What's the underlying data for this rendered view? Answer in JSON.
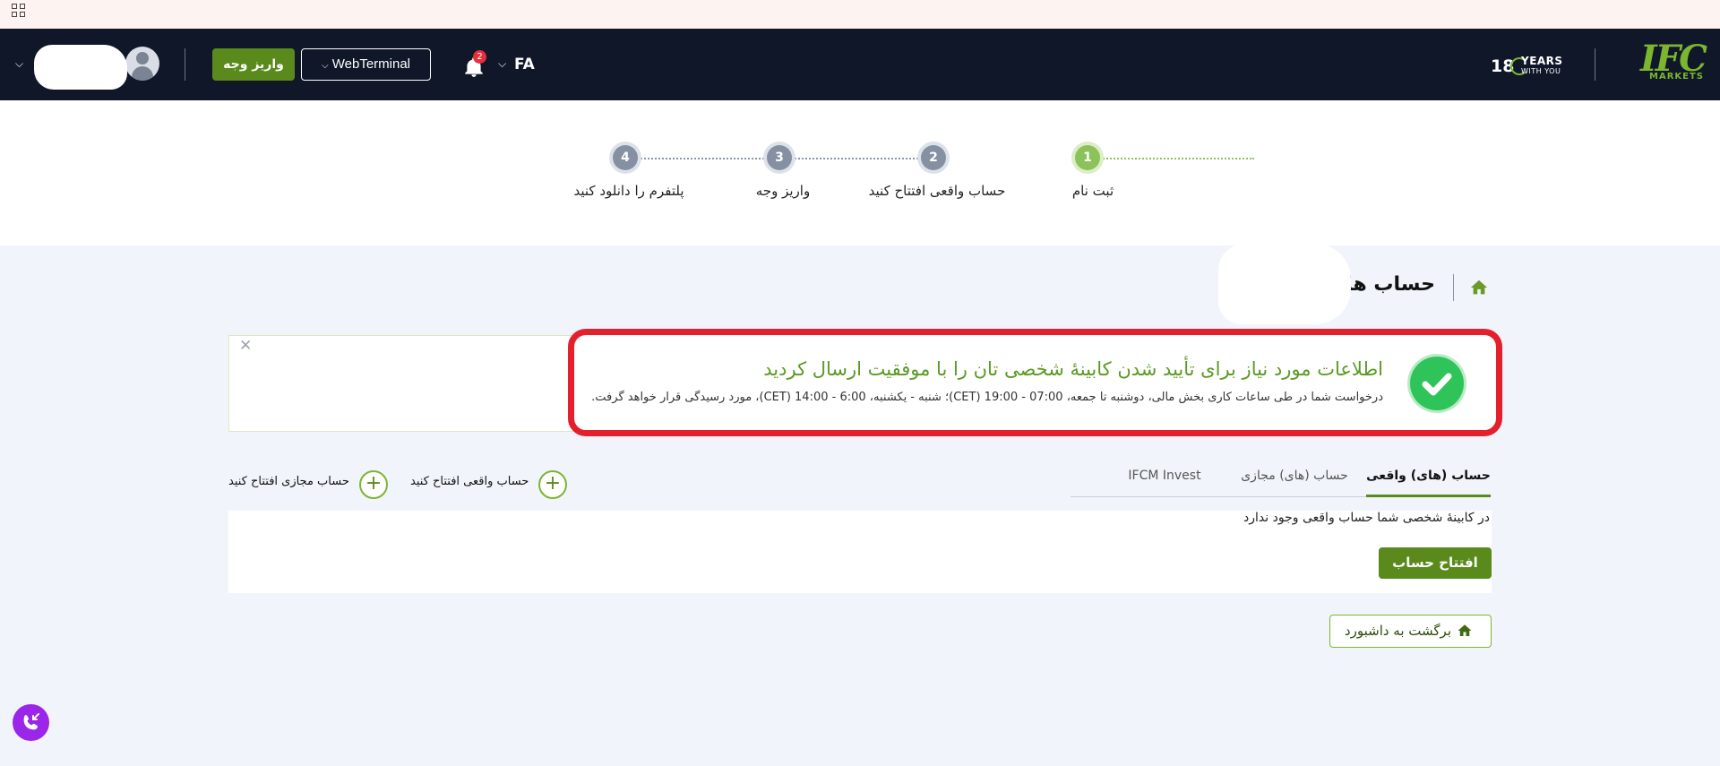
{
  "header": {
    "logo_text": "IFC",
    "logo_sub": "MARKETS",
    "years_number": "18",
    "years_text": "YEARS",
    "years_subtext": "WITH YOU",
    "language": "FA",
    "notification_count": "2",
    "webterminal_label": "WebTerminal",
    "deposit_label": "واریز وجه"
  },
  "stepper": {
    "steps": [
      {
        "number": "1",
        "label": "ثبت نام",
        "state": "done"
      },
      {
        "number": "2",
        "label": "حساب واقعی افتتاح کنید",
        "state": "pending"
      },
      {
        "number": "3",
        "label": "واریز وجه",
        "state": "pending"
      },
      {
        "number": "4",
        "label": "پلتفرم را دانلود کنید",
        "state": "pending"
      }
    ]
  },
  "page": {
    "title": "حساب ها"
  },
  "notice": {
    "title": "اطلاعات مورد نیاز برای تأیید شدن کابینهٔ شخصی تان را با موفقیت ارسال کردید",
    "text": "درخواست شما در طی ساعات کاری بخش مالی، دوشنبه تا جمعه، 07:00 - 19:00 (CET)؛ شنبه - یکشنبه، 6:00 - 14:00 (CET)، مورد رسیدگی قرار خواهد گرفت."
  },
  "tabs": [
    {
      "label": "حساب (های) واقعی",
      "active": true
    },
    {
      "label": "حساب (های) مجازی",
      "active": false
    },
    {
      "label": "IFCM Invest",
      "active": false
    }
  ],
  "actions": {
    "open_real": "حساب واقعی افتتاح کنید",
    "open_demo": "حساب مجازی افتتاح کنید"
  },
  "panel": {
    "empty_message": "در کابینهٔ شخصی شما حساب واقعی وجود ندارد",
    "open_account_label": "افتتاح حساب"
  },
  "back_label": "برگشت به داشبورد",
  "colors": {
    "brand_green": "#5a8a1c",
    "header_bg": "#0f1729",
    "highlight_red": "#e5202d",
    "success_green": "#2fc45a",
    "call_purple": "#9b25e8"
  }
}
